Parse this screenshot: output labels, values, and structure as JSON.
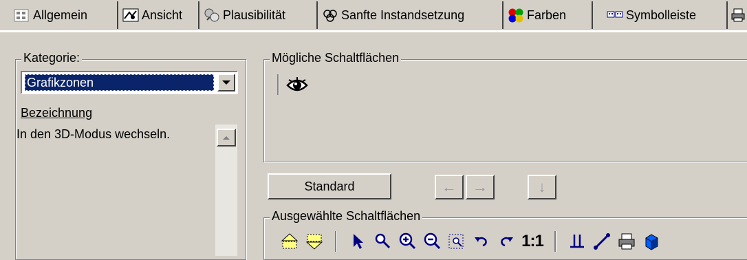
{
  "tabs": [
    {
      "label": "Allgemein",
      "icon": "general-icon",
      "active": false
    },
    {
      "label": "Ansicht",
      "icon": "view-icon",
      "active": false
    },
    {
      "label": "Plausibilität",
      "icon": "plausibility-icon",
      "active": false
    },
    {
      "label": "Sanfte Instandsetzung",
      "icon": "soft-repair-icon",
      "active": false
    },
    {
      "label": "Farben",
      "icon": "colors-icon",
      "active": false
    },
    {
      "label": "Symbolleiste",
      "icon": "toolbar-icon",
      "active": true
    }
  ],
  "category": {
    "legend": "Kategorie:",
    "selected": "Grafikzonen",
    "description_label": "Bezeichnung",
    "description_text": "In den 3D-Modus wechseln."
  },
  "possible": {
    "legend": "Mögliche Schaltflächen",
    "buttons": [
      "3d-view-icon"
    ]
  },
  "controls": {
    "standard_label": "Standard",
    "left_arrow": "←",
    "right_arrow": "→",
    "down_arrow": "↓"
  },
  "selected": {
    "legend": "Ausgewählte Schaltflächen",
    "one_to_one": "1:1",
    "icons": [
      "zone-up-icon",
      "zone-down-icon",
      "pointer-icon",
      "zoom-select-icon",
      "zoom-in-icon",
      "zoom-out-icon",
      "zoom-window-icon",
      "undo-icon",
      "redo-icon",
      "one-to-one-icon",
      "ground-icon",
      "line-icon",
      "print-icon",
      "cube-icon"
    ]
  },
  "colors": {
    "selection": "#0a246a",
    "face": "#d4d0c8"
  }
}
